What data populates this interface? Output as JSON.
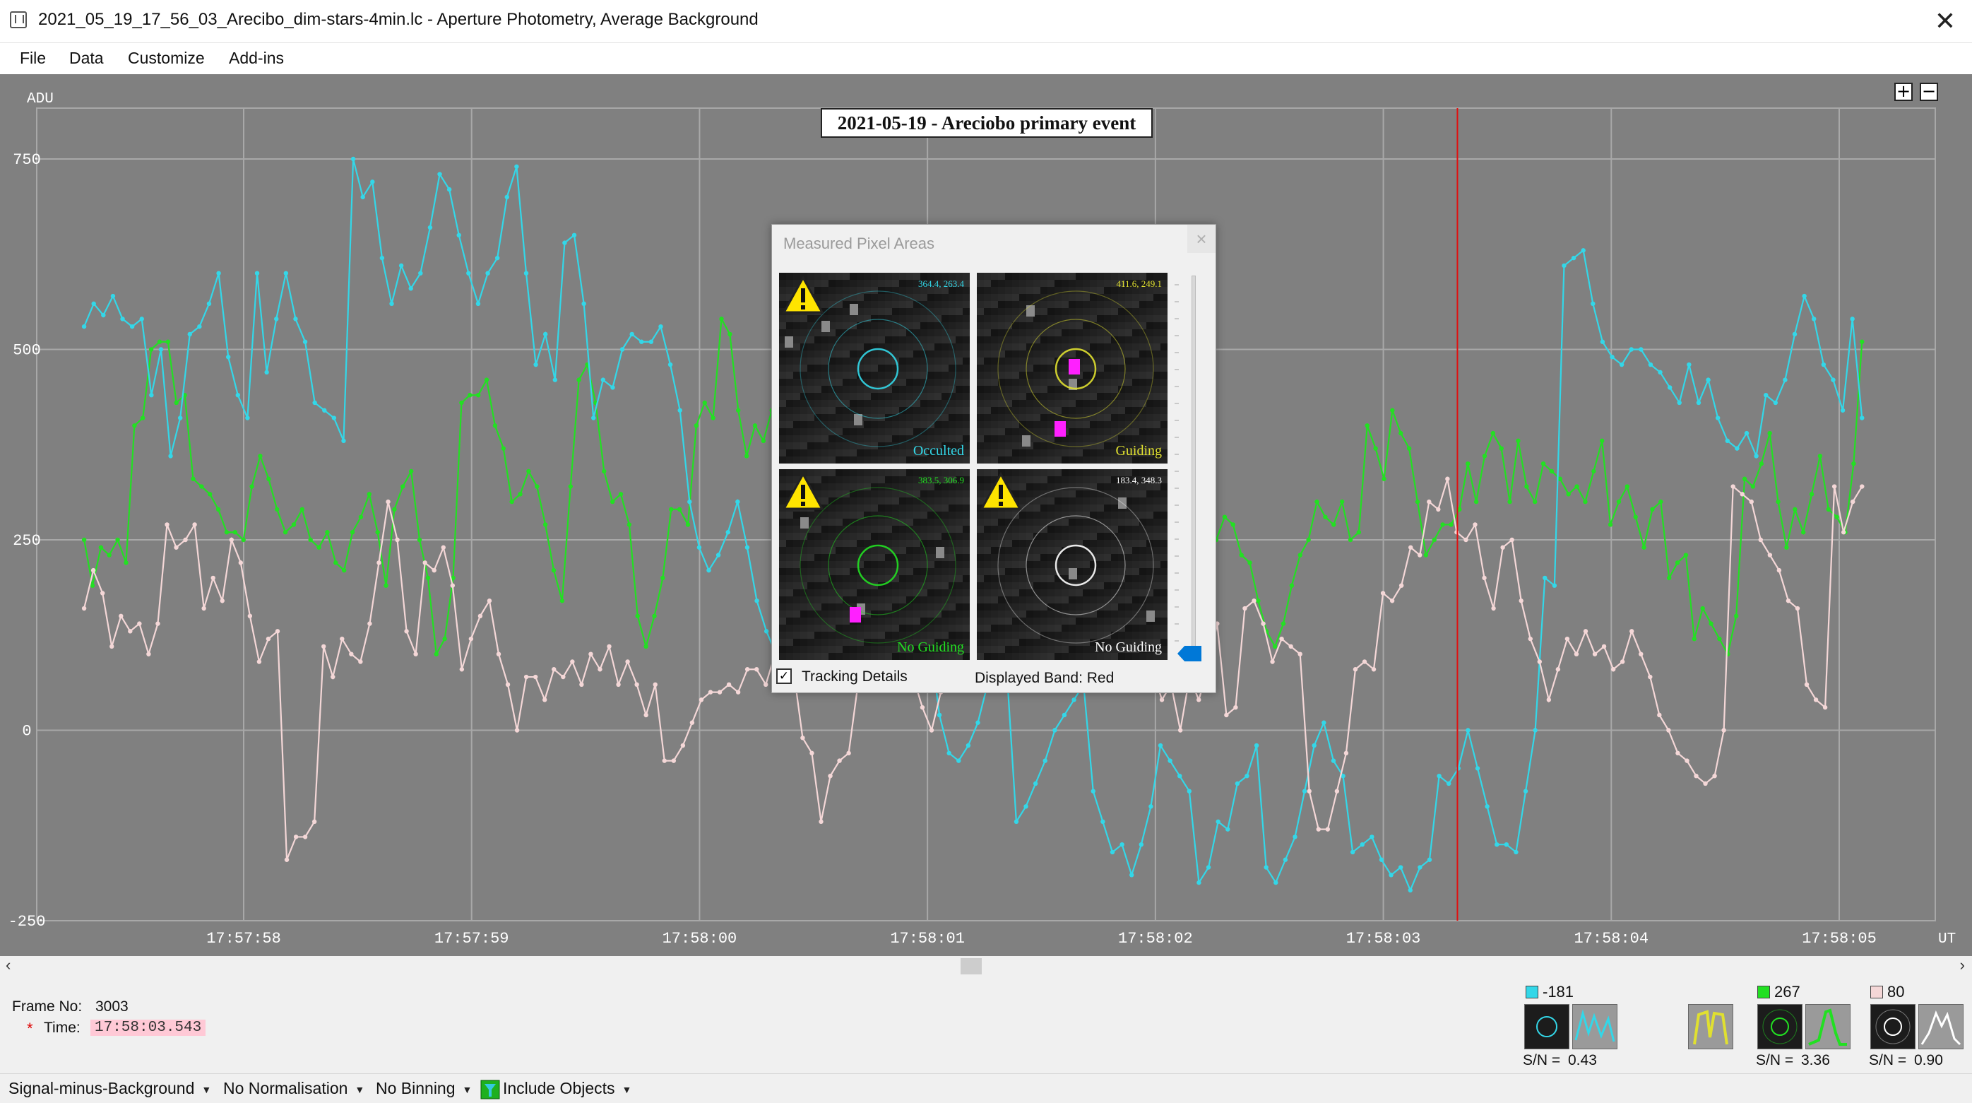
{
  "window": {
    "title": "2021_05_19_17_56_03_Arecibo_dim-stars-4min.lc - Aperture Photometry, Average Background",
    "close_glyph": "✕"
  },
  "menu": {
    "items": [
      "File",
      "Data",
      "Customize",
      "Add-ins"
    ]
  },
  "zoom": {
    "plus": "+",
    "minus": "−"
  },
  "colors": {
    "plot_bg": "#808080",
    "grid": "#a8a8a8",
    "cyan_series": "#33d7e8",
    "green_series": "#22e022",
    "pink_series": "#f4d7d7",
    "cursor": "#e01010"
  },
  "chart_data": {
    "type": "line",
    "title": "2021-05-19 - Areciobo primary event",
    "ylabel": "ADU",
    "xlabel": "UT",
    "ylim": [
      -250,
      900
    ],
    "yticks": [
      -250,
      0,
      250,
      500,
      750
    ],
    "x_range": [
      0,
      32
    ],
    "xtick_labels": [
      {
        "x": 4,
        "label": "17:57:58"
      },
      {
        "x": 8,
        "label": "17:57:59"
      },
      {
        "x": 12,
        "label": "17:58:00"
      },
      {
        "x": 16,
        "label": "17:58:01"
      },
      {
        "x": 20,
        "label": "17:58:02"
      },
      {
        "x": 24,
        "label": "17:58:03"
      },
      {
        "x": 28,
        "label": "17:58:04"
      },
      {
        "x": 32,
        "label": "17:58:05"
      }
    ],
    "cursor_x": 25.3,
    "grid": true,
    "series": [
      {
        "color": "cyan",
        "values": [
          530,
          560,
          540,
          545,
          570,
          540,
          520,
          540,
          510,
          380,
          500,
          360,
          410,
          520,
          530,
          600,
          430,
          380,
          600,
          480,
          550,
          510,
          540,
          440,
          590,
          440,
          650,
          560,
          620,
          600,
          520,
          420,
          410,
          400,
          380,
          640,
          760,
          680,
          730,
          600,
          570,
          560,
          580,
          620,
          560,
          690,
          560,
          600,
          540,
          610,
          500,
          690,
          730,
          710,
          650,
          700,
          540,
          560,
          490,
          640,
          750,
          720,
          650,
          550,
          430,
          580,
          690,
          700,
          520,
          560,
          660,
          700,
          780,
          750,
          720,
          580,
          450,
          500,
          550,
          500,
          470,
          600,
          700,
          760,
          650,
          530,
          440,
          450,
          400,
          480,
          520,
          500,
          560,
          530,
          510,
          380,
          400,
          430,
          600,
          700,
          650,
          510,
          550,
          600,
          620,
          540,
          480,
          500,
          520,
          560,
          480,
          330,
          410,
          420,
          300,
          200,
          250,
          280,
          300,
          350,
          420,
          490,
          520,
          450,
          380,
          430,
          450,
          380,
          400,
          480,
          440,
          500,
          420,
          380,
          330,
          260,
          180,
          230,
          290,
          310,
          180,
          100,
          80,
          80,
          40,
          130,
          200,
          240,
          300,
          330,
          350,
          300,
          250,
          200,
          150,
          120,
          70,
          60,
          30,
          0,
          -30,
          -10,
          -40,
          -20,
          10,
          40,
          80,
          100,
          120,
          130,
          150,
          130,
          100,
          60,
          30,
          0,
          -90,
          -130,
          -100,
          -50,
          -100,
          -120,
          -190,
          -150,
          -120,
          -130,
          -60,
          -80,
          -40,
          0,
          -20,
          -80,
          -120,
          -160,
          -150,
          -130,
          -90,
          -40,
          -10,
          10,
          30,
          40,
          60,
          70,
          80,
          90,
          120,
          180,
          220,
          280,
          350,
          450,
          520,
          620,
          600,
          630,
          560,
          520,
          490,
          470,
          500,
          480,
          440,
          430,
          400,
          380,
          410,
          390,
          450,
          380,
          420,
          480,
          520,
          560,
          540,
          500,
          470,
          440,
          430,
          420,
          410,
          500,
          520
        ],
        "note": ""
      }
    ]
  },
  "series_points": {
    "cyan": [
      530,
      560,
      545,
      570,
      540,
      530,
      540,
      440,
      500,
      360,
      410,
      520,
      530,
      560,
      600,
      490,
      440,
      410,
      600,
      470,
      540,
      600,
      540,
      510,
      430,
      420,
      410,
      380,
      750,
      700,
      720,
      620,
      560,
      610,
      580,
      600,
      660,
      730,
      710,
      650,
      600,
      560,
      600,
      620,
      700,
      740,
      600,
      480,
      520,
      460,
      640,
      650,
      560,
      410,
      460,
      450,
      500,
      520,
      510,
      510,
      530,
      480,
      420,
      300,
      240,
      210,
      230,
      260,
      300,
      240,
      170,
      130,
      100,
      80,
      90,
      100,
      130,
      200,
      300,
      340,
      430,
      440,
      400,
      370,
      350,
      300,
      250,
      210,
      120,
      20,
      -30,
      -40,
      -20,
      10,
      60,
      70,
      80,
      -120,
      -100,
      -70,
      -40,
      0,
      20,
      40,
      60,
      -80,
      -120,
      -160,
      -150,
      -190,
      -150,
      -100,
      -20,
      -40,
      -60,
      -80,
      -200,
      -180,
      -120,
      -130,
      -70,
      -60,
      -20,
      -180,
      -200,
      -170,
      -140,
      -80,
      -20,
      10,
      -40,
      -60,
      -160,
      -150,
      -140,
      -170,
      -190,
      -180,
      -210,
      -180,
      -170,
      -60,
      -70,
      -50,
      0,
      -50,
      -100,
      -150,
      -150,
      -160,
      -80,
      0,
      200,
      190,
      610,
      620,
      630,
      560,
      510,
      490,
      480,
      500,
      500,
      480,
      470,
      450,
      430,
      480,
      430,
      460,
      410,
      380,
      370,
      390,
      360,
      440,
      430,
      460,
      520,
      570,
      540,
      480,
      460,
      420,
      540,
      410
    ],
    "green": [
      250,
      190,
      240,
      230,
      250,
      220,
      400,
      410,
      500,
      510,
      510,
      430,
      440,
      330,
      320,
      310,
      290,
      260,
      260,
      250,
      320,
      360,
      330,
      290,
      260,
      270,
      290,
      250,
      240,
      260,
      220,
      210,
      260,
      280,
      310,
      260,
      190,
      290,
      320,
      340,
      250,
      200,
      100,
      120,
      200,
      430,
      440,
      440,
      460,
      400,
      370,
      300,
      310,
      340,
      320,
      270,
      210,
      170,
      320,
      460,
      480,
      430,
      340,
      300,
      310,
      270,
      150,
      110,
      150,
      200,
      290,
      290,
      270,
      400,
      430,
      410,
      540,
      520,
      420,
      360,
      400,
      380,
      420,
      420,
      360,
      260,
      250,
      160,
      200,
      240,
      280,
      260,
      150,
      200,
      130,
      170,
      190,
      200,
      150,
      180,
      150,
      180,
      160,
      220,
      250,
      290,
      230,
      200,
      130,
      160,
      140,
      120,
      180,
      190,
      250,
      330,
      350,
      300,
      290,
      250,
      220,
      200,
      180,
      140,
      100,
      120,
      80,
      100,
      130,
      150,
      200,
      220,
      210,
      170,
      240,
      250,
      280,
      270,
      230,
      220,
      170,
      130,
      110,
      140,
      190,
      230,
      250,
      300,
      280,
      270,
      300,
      250,
      260,
      400,
      370,
      330,
      420,
      390,
      370,
      300,
      230,
      250,
      270,
      270,
      290,
      350,
      300,
      360,
      390,
      370,
      300,
      380,
      320,
      300,
      350,
      340,
      330,
      310,
      320,
      300,
      340,
      380,
      270,
      300,
      320,
      280,
      240,
      290,
      300,
      200,
      220,
      230,
      120,
      160,
      140,
      120,
      100,
      150,
      330,
      320,
      350,
      390,
      300,
      240,
      290,
      260,
      310,
      360,
      290,
      280,
      260,
      350,
      510
    ],
    "pink": [
      160,
      210,
      180,
      110,
      150,
      130,
      140,
      100,
      140,
      270,
      240,
      250,
      270,
      160,
      200,
      170,
      250,
      220,
      150,
      90,
      120,
      130,
      -170,
      -140,
      -140,
      -120,
      110,
      70,
      120,
      100,
      90,
      140,
      220,
      300,
      250,
      130,
      100,
      220,
      210,
      240,
      190,
      80,
      120,
      150,
      170,
      100,
      60,
      0,
      70,
      70,
      40,
      80,
      70,
      90,
      60,
      100,
      80,
      110,
      60,
      90,
      60,
      20,
      60,
      -40,
      -40,
      -20,
      10,
      40,
      50,
      50,
      60,
      50,
      80,
      80,
      60,
      100,
      110,
      80,
      -10,
      -30,
      -120,
      -60,
      -40,
      -30,
      60,
      100,
      130,
      100,
      90,
      110,
      70,
      30,
      0,
      50,
      90,
      170,
      60,
      150,
      160,
      170,
      210,
      190,
      250,
      190,
      240,
      230,
      220,
      170,
      120,
      120,
      140,
      100,
      110,
      150,
      130,
      100,
      80,
      40,
      60,
      0,
      70,
      40,
      80,
      140,
      20,
      30,
      160,
      170,
      140,
      90,
      120,
      110,
      100,
      -80,
      -130,
      -130,
      -80,
      -30,
      80,
      90,
      80,
      180,
      170,
      190,
      240,
      230,
      300,
      290,
      330,
      260,
      250,
      270,
      200,
      160,
      240,
      250,
      170,
      120,
      90,
      40,
      80,
      120,
      100,
      130,
      100,
      110,
      80,
      90,
      130,
      100,
      70,
      20,
      0,
      -30,
      -40,
      -60,
      -70,
      -60,
      0,
      320,
      310,
      300,
      250,
      230,
      210,
      170,
      160,
      60,
      40,
      30,
      320,
      260,
      300,
      320
    ]
  },
  "dialog": {
    "title": "Measured Pixel Areas",
    "close_glyph": "×",
    "cells": [
      {
        "coords": "364.4, 263.4",
        "status": "Occulted",
        "color": "#33d7e8"
      },
      {
        "coords": "411.6, 249.1",
        "status": "Guiding",
        "color": "#e0e030"
      },
      {
        "coords": "383.5, 306.9",
        "status": "No Guiding",
        "color": "#22e022"
      },
      {
        "coords": "183.4, 348.3",
        "status": "No Guiding",
        "color": "#ffffff"
      }
    ],
    "tracking_checked": "✓",
    "tracking_label": "Tracking Details",
    "band_label": "Displayed Band: Red"
  },
  "frame": {
    "frame_label": "Frame No:",
    "frame_value": "3003",
    "time_marker": "*",
    "time_label": "Time:",
    "time_value": "17:58:03.543"
  },
  "targets": [
    {
      "value": "-181",
      "color": "#33d7e8",
      "sn_label": "S/N =",
      "sn_value": "0.43"
    },
    {
      "value": "267",
      "color": "#22e022",
      "sn_label": "S/N =",
      "sn_value": "3.36"
    },
    {
      "value": "80",
      "color": "#f4d7d7",
      "sn_label": "S/N =",
      "sn_value": "0.90"
    }
  ],
  "footer": {
    "mode": "Signal-minus-Background",
    "normalisation": "No Normalisation",
    "binning": "No Binning",
    "objects": "Include Objects"
  }
}
